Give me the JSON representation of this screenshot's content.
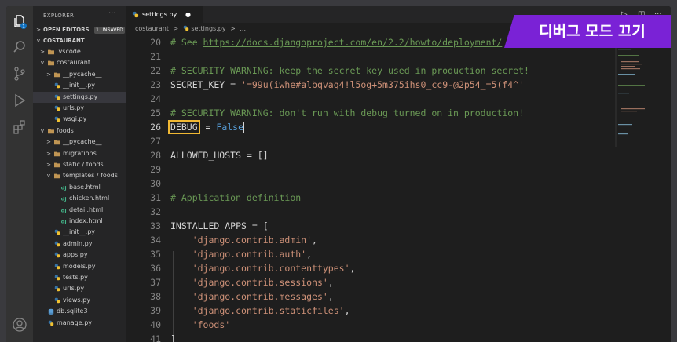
{
  "explorer": {
    "title": "EXPLORER",
    "more": "···",
    "open_editors": {
      "label": "OPEN EDITORS",
      "badge": "1 UNSAVED"
    },
    "project": "COSTAURANT",
    "tree": [
      {
        "label": ".vscode",
        "kind": "folder",
        "expanded": false,
        "level": 1
      },
      {
        "label": "costaurant",
        "kind": "folder",
        "expanded": true,
        "level": 1
      },
      {
        "label": "__pycache__",
        "kind": "folder",
        "expanded": false,
        "level": 2
      },
      {
        "label": "__init__.py",
        "kind": "python",
        "level": 2
      },
      {
        "label": "settings.py",
        "kind": "python",
        "level": 2,
        "selected": true
      },
      {
        "label": "urls.py",
        "kind": "python",
        "level": 2
      },
      {
        "label": "wsgi.py",
        "kind": "python",
        "level": 2
      },
      {
        "label": "foods",
        "kind": "folder",
        "expanded": true,
        "level": 1
      },
      {
        "label": "__pycache__",
        "kind": "folder",
        "expanded": false,
        "level": 2
      },
      {
        "label": "migrations",
        "kind": "folder",
        "expanded": false,
        "level": 2
      },
      {
        "label": "static / foods",
        "kind": "folder",
        "expanded": false,
        "level": 2
      },
      {
        "label": "templates / foods",
        "kind": "folder",
        "expanded": true,
        "level": 2
      },
      {
        "label": "base.html",
        "kind": "django",
        "level": 3
      },
      {
        "label": "chicken.html",
        "kind": "django",
        "level": 3
      },
      {
        "label": "detail.html",
        "kind": "django",
        "level": 3
      },
      {
        "label": "index.html",
        "kind": "django",
        "level": 3
      },
      {
        "label": "__init__.py",
        "kind": "python",
        "level": 2
      },
      {
        "label": "admin.py",
        "kind": "python",
        "level": 2
      },
      {
        "label": "apps.py",
        "kind": "python",
        "level": 2
      },
      {
        "label": "models.py",
        "kind": "python",
        "level": 2
      },
      {
        "label": "tests.py",
        "kind": "python",
        "level": 2
      },
      {
        "label": "urls.py",
        "kind": "python",
        "level": 2
      },
      {
        "label": "views.py",
        "kind": "python",
        "level": 2
      },
      {
        "label": "db.sqlite3",
        "kind": "db",
        "level": 1
      },
      {
        "label": "manage.py",
        "kind": "python",
        "level": 1
      }
    ]
  },
  "tab": {
    "label": "settings.py",
    "modified_dot": "●"
  },
  "breadcrumb": {
    "folder": "costaurant",
    "sep1": ">",
    "file": "settings.py",
    "sep2": ">",
    "rest": "..."
  },
  "code_lines": [
    {
      "n": "20",
      "parts": [
        {
          "t": "# See ",
          "c": "cm"
        },
        {
          "t": "https://docs.djangoproject.com/en/2.2/howto/deployment/",
          "c": "cm url"
        }
      ]
    },
    {
      "n": "21",
      "parts": []
    },
    {
      "n": "22",
      "parts": [
        {
          "t": "# SECURITY WARNING: keep the secret key used in production secret!",
          "c": "cm"
        }
      ]
    },
    {
      "n": "23",
      "parts": [
        {
          "t": "SECRET_KEY",
          "c": "var"
        },
        {
          "t": " = ",
          "c": "var"
        },
        {
          "t": "'=99u(iwhe#albqvaq4!l5og+5m375ihs0_cc9-@2p54_=5(f4^'",
          "c": "str"
        }
      ]
    },
    {
      "n": "24",
      "parts": []
    },
    {
      "n": "25",
      "parts": [
        {
          "t": "# SECURITY WARNING: don't run with debug turned on in production!",
          "c": "cm"
        }
      ]
    },
    {
      "n": "26",
      "parts": [
        {
          "t": "DEBUG",
          "c": "var hl"
        },
        {
          "t": " = ",
          "c": "var"
        },
        {
          "t": "False",
          "c": "kw"
        },
        {
          "t": "",
          "c": "cursor"
        }
      ],
      "current": true
    },
    {
      "n": "27",
      "parts": []
    },
    {
      "n": "28",
      "parts": [
        {
          "t": "ALLOWED_HOSTS",
          "c": "var"
        },
        {
          "t": " = []",
          "c": "var"
        }
      ]
    },
    {
      "n": "29",
      "parts": []
    },
    {
      "n": "30",
      "parts": []
    },
    {
      "n": "31",
      "parts": [
        {
          "t": "# Application definition",
          "c": "cm"
        }
      ]
    },
    {
      "n": "32",
      "parts": []
    },
    {
      "n": "33",
      "parts": [
        {
          "t": "INSTALLED_APPS",
          "c": "var"
        },
        {
          "t": " = [",
          "c": "var"
        }
      ]
    },
    {
      "n": "34",
      "parts": [
        {
          "t": "    ",
          "c": "var"
        },
        {
          "t": "'django.contrib.admin'",
          "c": "str"
        },
        {
          "t": ",",
          "c": "var"
        }
      ]
    },
    {
      "n": "35",
      "parts": [
        {
          "t": "    ",
          "c": "var"
        },
        {
          "t": "'django.contrib.auth'",
          "c": "str"
        },
        {
          "t": ",",
          "c": "var"
        }
      ]
    },
    {
      "n": "36",
      "parts": [
        {
          "t": "    ",
          "c": "var"
        },
        {
          "t": "'django.contrib.contenttypes'",
          "c": "str"
        },
        {
          "t": ",",
          "c": "var"
        }
      ]
    },
    {
      "n": "37",
      "parts": [
        {
          "t": "    ",
          "c": "var"
        },
        {
          "t": "'django.contrib.sessions'",
          "c": "str"
        },
        {
          "t": ",",
          "c": "var"
        }
      ]
    },
    {
      "n": "38",
      "parts": [
        {
          "t": "    ",
          "c": "var"
        },
        {
          "t": "'django.contrib.messages'",
          "c": "str"
        },
        {
          "t": ",",
          "c": "var"
        }
      ]
    },
    {
      "n": "39",
      "parts": [
        {
          "t": "    ",
          "c": "var"
        },
        {
          "t": "'django.contrib.staticfiles'",
          "c": "str"
        },
        {
          "t": ",",
          "c": "var"
        }
      ]
    },
    {
      "n": "40",
      "parts": [
        {
          "t": "    ",
          "c": "var"
        },
        {
          "t": "'foods'",
          "c": "str"
        }
      ]
    },
    {
      "n": "41",
      "parts": [
        {
          "t": "]",
          "c": "var"
        }
      ]
    }
  ],
  "banner": {
    "text": "디버그 모드 끄기"
  },
  "colors": {
    "accent": "#7a22d6",
    "highlight": "#f0b833",
    "badge": "#0e70c0"
  }
}
